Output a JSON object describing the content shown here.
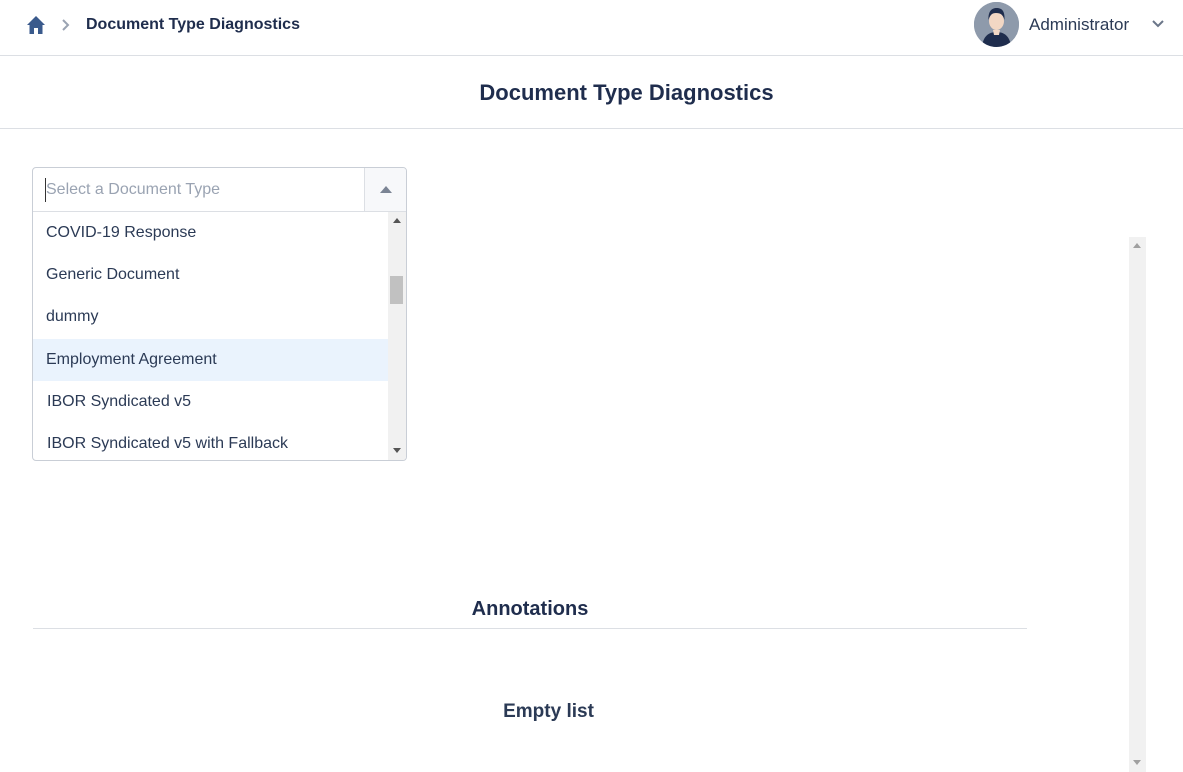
{
  "breadcrumb": {
    "home_icon": "home-icon",
    "separator_icon": "chevron-right-icon",
    "current": "Document Type Diagnostics"
  },
  "user": {
    "name": "Administrator",
    "avatar_icon": "user-avatar-icon",
    "menu_icon": "chevron-down-icon"
  },
  "page": {
    "title": "Document Type Diagnostics"
  },
  "document_type_select": {
    "placeholder": "Select a Document Type",
    "value": "",
    "options": [
      "COVID-19 Response",
      "Generic Document",
      "dummy",
      "Employment Agreement",
      "IBOR Syndicated v5",
      "IBOR Syndicated v5 with Fallback"
    ],
    "highlighted_index": 3
  },
  "annotations": {
    "title": "Annotations",
    "empty_text": "Empty list"
  },
  "colors": {
    "text": "#1f2d4d",
    "highlight": "#eaf3fd",
    "border": "#dcdfe4"
  }
}
